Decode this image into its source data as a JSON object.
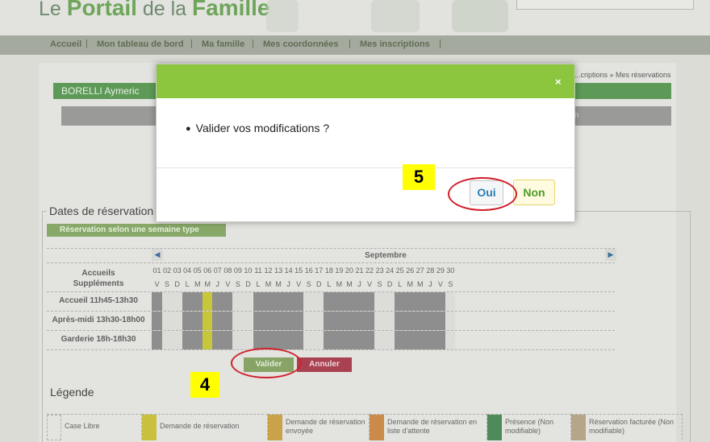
{
  "header": {
    "logo_pre": "Le ",
    "logo_bold1": "Portail",
    "logo_mid": " de la ",
    "logo_bold2": "Famille"
  },
  "nav": {
    "items": [
      "Accueil",
      "Mon tableau de bord",
      "Ma famille",
      "Mes coordonnées",
      "Mes inscriptions"
    ]
  },
  "breadcrumb": "...criptions » Mes réservations",
  "user": {
    "name": "BORELLI Aymeric"
  },
  "greybar_text": "n",
  "reservation": {
    "section_title": "Dates de réservation",
    "semaine_type_label": "Réservation selon une semaine type",
    "month": "Septembre",
    "header_line1": "Accueils",
    "header_line2": "Suppléments",
    "days": [
      "01",
      "02",
      "03",
      "04",
      "05",
      "06",
      "07",
      "08",
      "09",
      "10",
      "11",
      "12",
      "13",
      "14",
      "15",
      "16",
      "17",
      "18",
      "19",
      "20",
      "21",
      "22",
      "23",
      "24",
      "25",
      "26",
      "27",
      "28",
      "29",
      "30"
    ],
    "weekdays": [
      "V",
      "S",
      "D",
      "L",
      "M",
      "M",
      "J",
      "V",
      "S",
      "D",
      "L",
      "M",
      "M",
      "J",
      "V",
      "S",
      "D",
      "L",
      "M",
      "M",
      "J",
      "V",
      "S",
      "D",
      "L",
      "M",
      "M",
      "J",
      "V",
      "S"
    ],
    "rows": [
      "Accueil 11h45-13h30",
      "Après-midi 13h30-18h00",
      "Garderie 18h-18h30"
    ],
    "valider_label": "Valider",
    "annuler_label": "Annuler"
  },
  "legend": {
    "title": "Légende",
    "items": [
      {
        "label": "Case Libre",
        "color": "#e3e3df"
      },
      {
        "label": "Demande de réservation",
        "color": "#c9c13e"
      },
      {
        "label": "Demande de réservation envoyée",
        "color": "#c9a24a"
      },
      {
        "label": "Demande de réservation en liste d'attente",
        "color": "#c98a4a"
      },
      {
        "label": "Présence (Non modifiable)",
        "color": "#4f8a5a"
      },
      {
        "label": "Réservation facturée (Non modifiable)",
        "color": "#b5a68a"
      }
    ]
  },
  "annotations": {
    "step4": "4",
    "step5": "5"
  },
  "modal": {
    "close_symbol": "×",
    "message": "Valider vos modifications ?",
    "yes_label": "Oui",
    "no_label": "Non"
  },
  "colors": {
    "modal_header": "#8cc63f",
    "annotation_ring": "#d0202a",
    "annotation_bg": "#ffff00"
  }
}
